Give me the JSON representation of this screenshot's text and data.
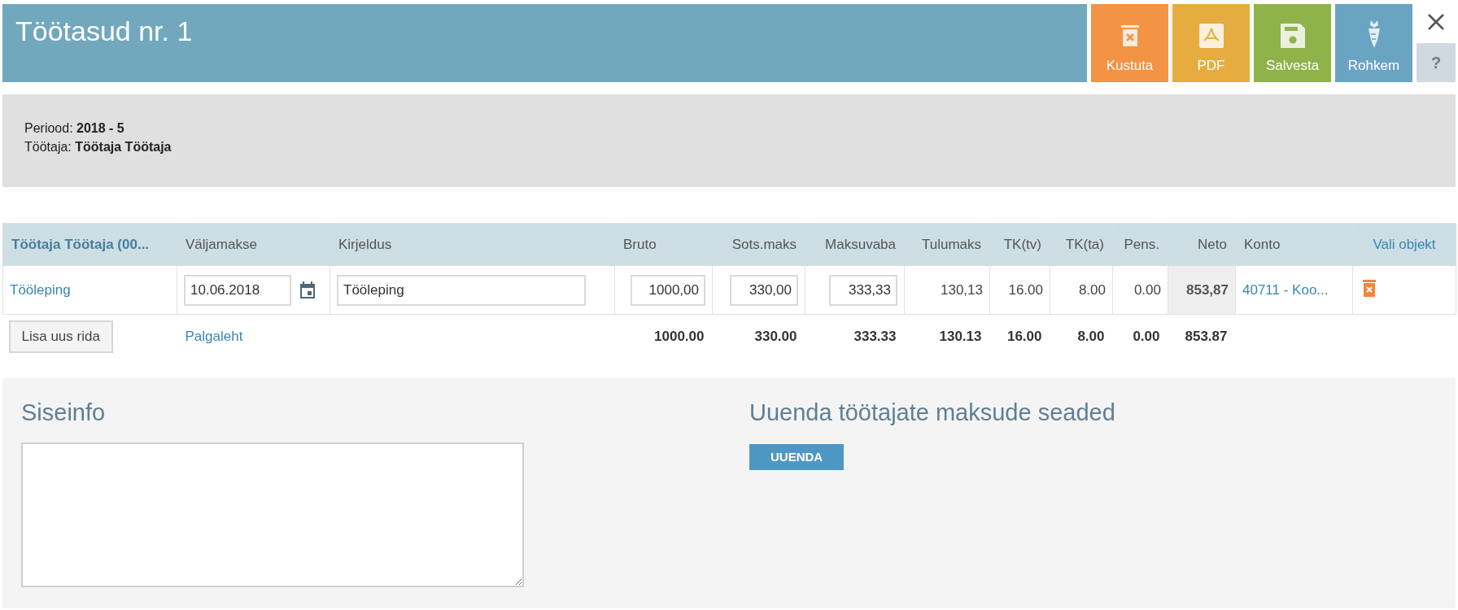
{
  "title": "Töötasud nr. 1",
  "toolbar": [
    {
      "kind": "delete",
      "label": "Kustuta"
    },
    {
      "kind": "pdf",
      "label": "PDF"
    },
    {
      "kind": "save",
      "label": "Salvesta"
    },
    {
      "kind": "more",
      "label": "Rohkem"
    }
  ],
  "help": "?",
  "info": [
    {
      "label": "Periood:",
      "value": "2018 - 5"
    },
    {
      "label": "Töötaja:",
      "value": "Töötaja Töötaja"
    }
  ],
  "table": {
    "columns": [
      {
        "kind": "bold",
        "label": "Töötaja Töötaja (00..."
      },
      {
        "kind": "plain",
        "label": "Väljamakse"
      },
      {
        "kind": "plain",
        "label": "Kirjeldus"
      },
      {
        "kind": "plain",
        "label": "Bruto"
      },
      {
        "kind": "plain",
        "label": "Sots.maks"
      },
      {
        "kind": "plain",
        "label": "Maksuvaba"
      },
      {
        "kind": "plain",
        "label": "Tulumaks"
      },
      {
        "kind": "plain",
        "label": "TK(tv)"
      },
      {
        "kind": "plain",
        "label": "TK(ta)"
      },
      {
        "kind": "plain",
        "label": "Pens."
      },
      {
        "kind": "plain",
        "label": "Neto"
      },
      {
        "kind": "plain",
        "label": "Konto"
      },
      {
        "kind": "link",
        "label": "Vali objekt"
      }
    ],
    "rows": [
      {
        "cells": [
          {
            "kind": "link",
            "text": "Tööleping"
          },
          {
            "kind": "date",
            "text": "10.06.2018"
          },
          {
            "kind": "input",
            "text": "Tööleping"
          },
          {
            "kind": "number-input",
            "text": "1000,00"
          },
          {
            "kind": "number-input",
            "text": "330,00"
          },
          {
            "kind": "number-input",
            "text": "333,33"
          },
          {
            "kind": "text",
            "text": "130,13"
          },
          {
            "kind": "text",
            "text": "16.00"
          },
          {
            "kind": "text",
            "text": "8.00"
          },
          {
            "kind": "text",
            "text": "0.00"
          },
          {
            "kind": "highlight",
            "text": "853,87"
          },
          {
            "kind": "link",
            "text": "40711 - Koo..."
          },
          {
            "kind": "delete"
          }
        ]
      }
    ],
    "totals": [
      {
        "kind": "button",
        "text": "Lisa uus rida"
      },
      {
        "kind": "link",
        "text": "Palgaleht"
      },
      {
        "kind": "blank"
      },
      {
        "kind": "total",
        "text": "1000.00"
      },
      {
        "kind": "total",
        "text": "330.00"
      },
      {
        "kind": "total",
        "text": "333.33"
      },
      {
        "kind": "total",
        "text": "130.13"
      },
      {
        "kind": "total",
        "text": "16.00"
      },
      {
        "kind": "total",
        "text": "8.00"
      },
      {
        "kind": "total",
        "text": "0.00"
      },
      {
        "kind": "total",
        "text": "853.87"
      },
      {
        "kind": "blank"
      },
      {
        "kind": "blank"
      }
    ]
  },
  "notes": {
    "heading": "Siseinfo"
  },
  "update": {
    "heading": "Uuenda töötajate maksude seaded",
    "button": "UUENDA"
  }
}
